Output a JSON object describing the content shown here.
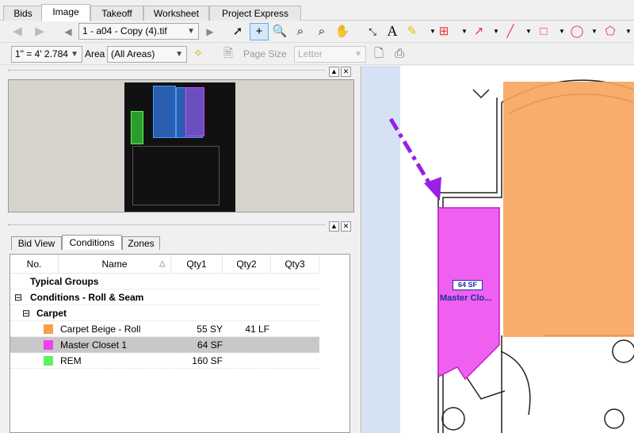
{
  "tabs": [
    {
      "label": "Bids"
    },
    {
      "label": "Image",
      "active": true
    },
    {
      "label": "Takeoff"
    },
    {
      "label": "Worksheet"
    },
    {
      "label": "Project Express"
    }
  ],
  "toolbar1": {
    "file_select": "1 - a04 - Copy (4).tif",
    "icons": [
      "back-icon",
      "forward-icon",
      "prev-page-icon",
      "next-page-icon",
      "pointer-icon",
      "crosshair-icon",
      "zoom-icon",
      "zoom-window-icon",
      "zoom-area-icon",
      "pan-hand-icon",
      "measure-icon",
      "text-icon",
      "highlighter-icon",
      "stamp-icon",
      "arrow-icon",
      "line-icon",
      "rectangle-icon",
      "ellipse-icon",
      "polygon-icon"
    ]
  },
  "toolbar2": {
    "scale": "1\" = 4' 2.784",
    "area_label": "Area",
    "area_select": "(All Areas)",
    "page_size_label": "Page Size",
    "page_size_select": "Letter"
  },
  "panel_tabs": [
    {
      "label": "Bid View"
    },
    {
      "label": "Conditions",
      "active": true
    },
    {
      "label": "Zones"
    }
  ],
  "grid": {
    "columns": [
      "No.",
      "Name",
      "Qty1",
      "Qty2",
      "Qty3"
    ],
    "rows": [
      {
        "name": "Typical Groups",
        "type": "group"
      },
      {
        "name": "Conditions - Roll & Seam",
        "type": "group",
        "expander": "⊟"
      },
      {
        "name": "Carpet",
        "type": "subgroup",
        "expander": "⊟"
      },
      {
        "name": "Carpet Beige - Roll",
        "qty1": "55 SY",
        "qty2": "41 LF",
        "color": "#f7a04a"
      },
      {
        "name": "Master Closet 1",
        "qty1": "64 SF",
        "qty2": "",
        "color": "#f040f0",
        "selected": true
      },
      {
        "name": "REM",
        "qty1": "160 SF",
        "qty2": "",
        "color": "#60f060"
      }
    ]
  },
  "drawing": {
    "label_qty": "64 SF",
    "label_name": "Master Clo...",
    "colors": {
      "orange": "#f7a45c",
      "magenta": "#f060f0",
      "arrow": "#9a1ee6"
    }
  }
}
